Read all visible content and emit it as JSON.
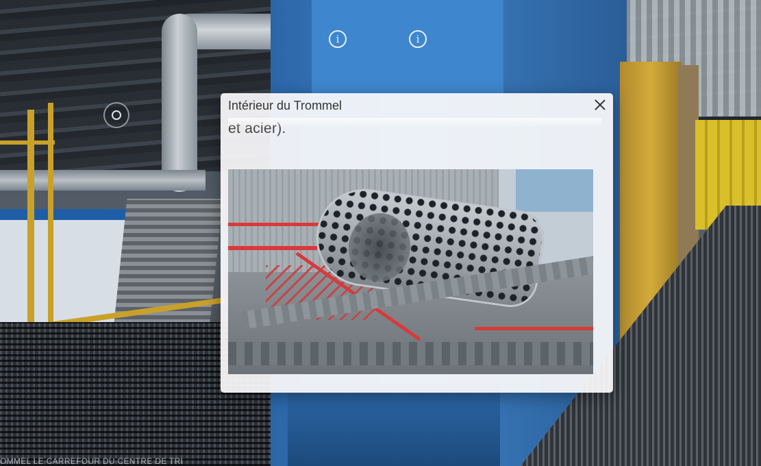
{
  "modal": {
    "title": "Intérieur du Trommel",
    "text": "et acier)."
  },
  "hotspots": {
    "info_glyph": "i"
  },
  "caption": "OMMEL LE CARREFOUR DU CENTRE DE TRI",
  "colors": {
    "modal_bg": "#fafafb",
    "hotspot": "#e8eef5",
    "machine_blue": "#3d7fc3",
    "railing_yellow": "#c9a12a"
  }
}
